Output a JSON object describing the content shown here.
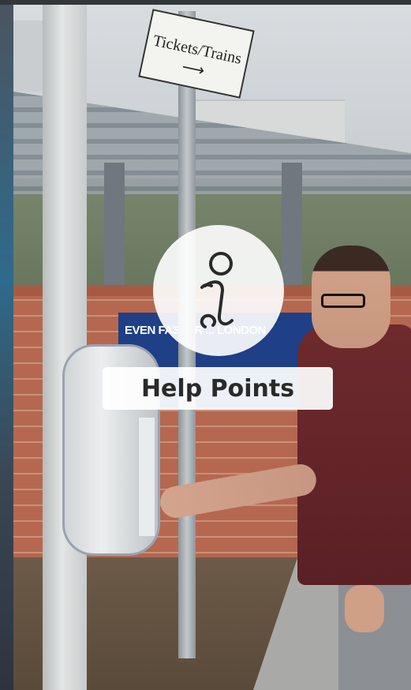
{
  "hero": {
    "alt": "Person using a help point at a train station",
    "station_sign": "Tickets/Trains ⟶",
    "banner_text": "EVEN FASTER ... LONDON",
    "info_icon": "info-icon",
    "label": "Help Points"
  },
  "colors": {
    "overlay": "#ffffff",
    "label_text": "#2a2a2a",
    "banner": "#1f3f86",
    "brick": "#b5684f"
  }
}
